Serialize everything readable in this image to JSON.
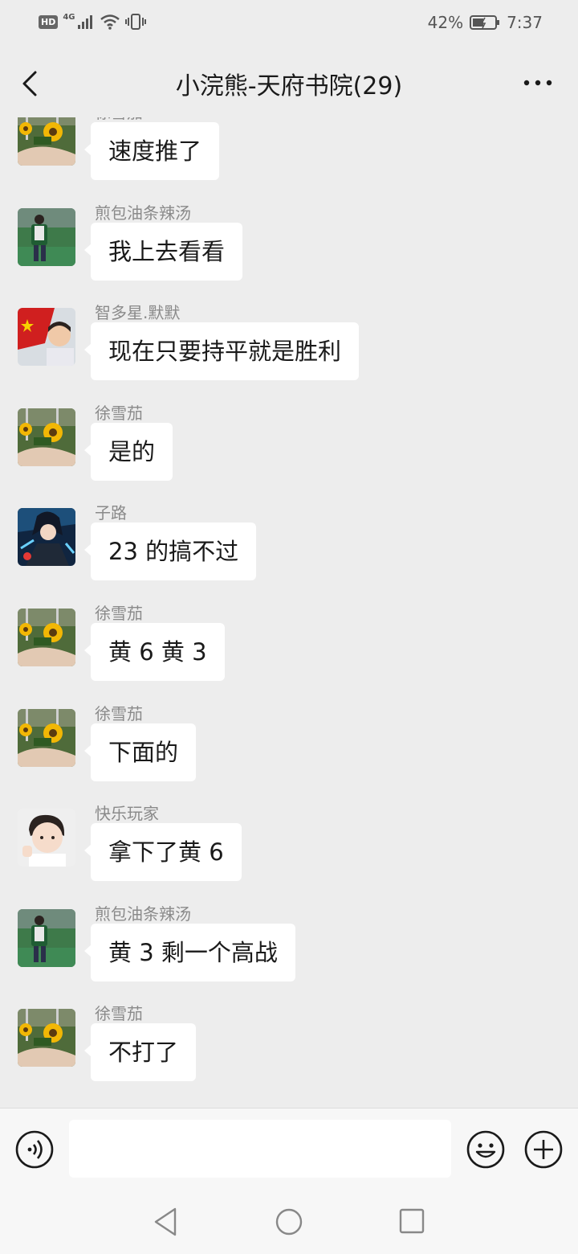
{
  "status_bar": {
    "hd": "HD",
    "network": "4G",
    "battery_percent": "42%",
    "time": "7:37"
  },
  "header": {
    "title": "小浣熊-天府书院(29)"
  },
  "messages": [
    {
      "sender": "徐雪茄",
      "text": "速度推了",
      "avatar": "sunflower"
    },
    {
      "sender": "煎包油条辣汤",
      "text": "我上去看看",
      "avatar": "field-boy"
    },
    {
      "sender": "智多星.默默",
      "text": "现在只要持平就是胜利",
      "avatar": "flag-kid"
    },
    {
      "sender": "徐雪茄",
      "text": "是的",
      "avatar": "sunflower"
    },
    {
      "sender": "子路",
      "text": "23 的搞不过",
      "avatar": "anime"
    },
    {
      "sender": "徐雪茄",
      "text": "黄 6 黄 3",
      "avatar": "sunflower"
    },
    {
      "sender": "徐雪茄",
      "text": "下面的",
      "avatar": "sunflower"
    },
    {
      "sender": "快乐玩家",
      "text": "拿下了黄 6",
      "avatar": "baby"
    },
    {
      "sender": "煎包油条辣汤",
      "text": "黄 3 剩一个高战",
      "avatar": "field-boy"
    },
    {
      "sender": "徐雪茄",
      "text": "不打了",
      "avatar": "sunflower"
    }
  ],
  "input": {
    "placeholder": "",
    "value": ""
  },
  "icons": {
    "back": "chevron-left-icon",
    "more": "more-dots-icon",
    "voice": "voice-icon",
    "emoji": "emoji-icon",
    "plus": "plus-icon",
    "nav_back": "triangle-back-icon",
    "nav_home": "circle-home-icon",
    "nav_recent": "square-recent-icon"
  }
}
